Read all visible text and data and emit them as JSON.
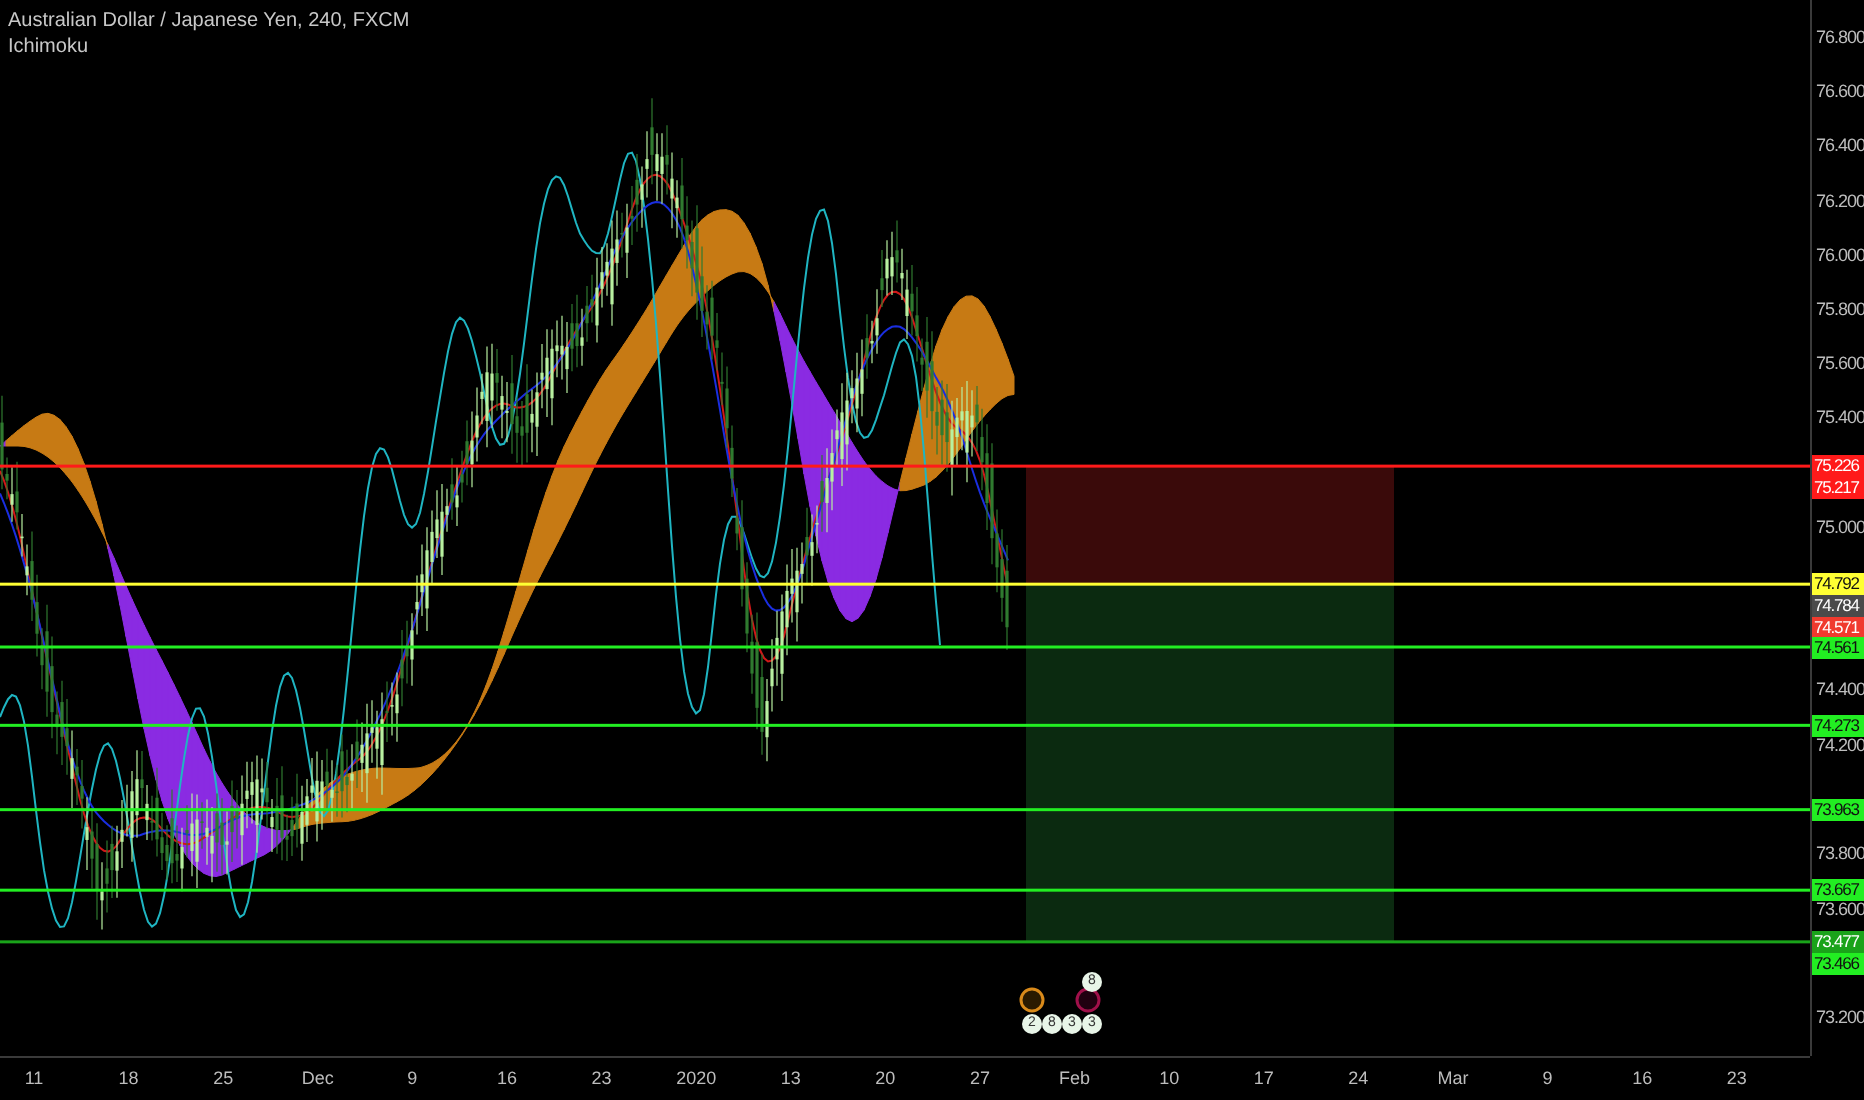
{
  "legend": {
    "title": "Australian Dollar / Japanese Yen, 240, FXCM",
    "indicator": "Ichimoku"
  },
  "price_ticks": [
    "76.800",
    "76.600",
    "76.400",
    "76.200",
    "76.000",
    "75.800",
    "75.600",
    "75.400",
    "75.000",
    "74.400",
    "74.200",
    "73.800",
    "73.600",
    "73.200"
  ],
  "price_labels": [
    {
      "text": "75.226",
      "color": "#ff1a1a",
      "line": true
    },
    {
      "text": "75.217",
      "color": "#ff1a1a",
      "line": false
    },
    {
      "text": "74.792",
      "color": "#ffff33",
      "line": true
    },
    {
      "text": "74.784",
      "color": "#4a4a4a",
      "line": false
    },
    {
      "text": "74.571",
      "color": "#f03a2e",
      "line": false
    },
    {
      "text": "74.561",
      "color": "#22ee22",
      "line": true
    },
    {
      "text": "74.273",
      "color": "#22ee22",
      "line": true
    },
    {
      "text": "73.963",
      "color": "#22ee22",
      "line": true
    },
    {
      "text": "73.667",
      "color": "#22ee22",
      "line": true
    },
    {
      "text": "73.477",
      "color": "#1aa31a",
      "line": true
    },
    {
      "text": "73.466",
      "color": "#22ee22",
      "line": false
    }
  ],
  "time_ticks": [
    "11",
    "18",
    "25",
    "Dec",
    "9",
    "16",
    "23",
    "2020",
    "13",
    "20",
    "27",
    "Feb",
    "10",
    "17",
    "24",
    "Mar",
    "9",
    "16",
    "23"
  ],
  "events": [
    {
      "text": "8"
    },
    {
      "text": "2"
    },
    {
      "text": "8"
    },
    {
      "text": "3"
    },
    {
      "text": "3"
    }
  ]
}
